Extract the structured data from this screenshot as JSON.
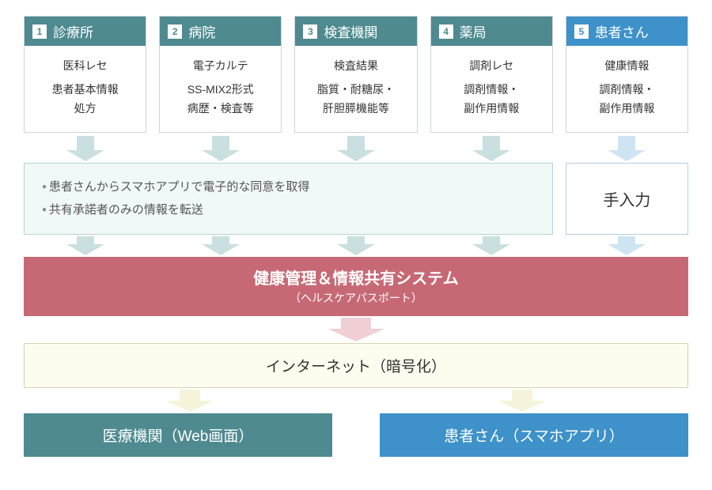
{
  "cards": [
    {
      "num": "1",
      "title": "診療所",
      "line1": "医科レセ",
      "line2": "患者基本情報",
      "line3": "処方",
      "variant": "teal"
    },
    {
      "num": "2",
      "title": "病院",
      "line1": "電子カルテ",
      "line2": "SS-MIX2形式",
      "line3": "病歴・検査等",
      "variant": "teal"
    },
    {
      "num": "3",
      "title": "検査機関",
      "line1": "検査結果",
      "line2": "脂質・耐糖尿・",
      "line3": "肝胆膵機能等",
      "variant": "teal"
    },
    {
      "num": "4",
      "title": "薬局",
      "line1": "調剤レセ",
      "line2": "調剤情報・",
      "line3": "副作用情報",
      "variant": "teal"
    },
    {
      "num": "5",
      "title": "患者さん",
      "line1": "健康情報",
      "line2": "調剤情報・",
      "line3": "副作用情報",
      "variant": "blue"
    }
  ],
  "consent": {
    "bullet1": "患者さんからスマホアプリで電子的な同意を取得",
    "bullet2": "共有承諾者のみの情報を転送"
  },
  "manual_input": "手入力",
  "system": {
    "title": "健康管理＆情報共有システム",
    "subtitle": "（ヘルスケアパスポート）"
  },
  "internet": "インターネット（暗号化）",
  "dest": {
    "left": "医療機関（Web画面）",
    "right": "患者さん（スマホアプリ）"
  }
}
